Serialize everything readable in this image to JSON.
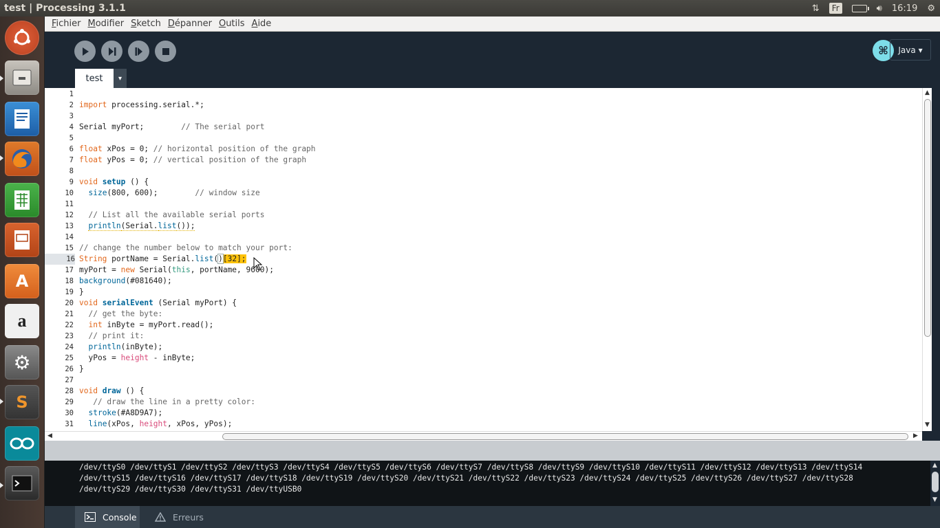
{
  "window": {
    "title": "test | Processing 3.1.1"
  },
  "tray": {
    "keyboard_layout": "Fr",
    "clock": "16:19"
  },
  "launcher": {
    "items": [
      {
        "name": "ubuntu-icon"
      },
      {
        "name": "files-icon"
      },
      {
        "name": "writer-icon"
      },
      {
        "name": "firefox-icon"
      },
      {
        "name": "calc-icon"
      },
      {
        "name": "impress-icon"
      },
      {
        "name": "software-center-icon"
      },
      {
        "name": "amazon-icon"
      },
      {
        "name": "system-settings-icon"
      },
      {
        "name": "sublime-text-icon"
      },
      {
        "name": "arduino-icon"
      },
      {
        "name": "terminal-icon"
      }
    ]
  },
  "menu": {
    "items": [
      {
        "first": "F",
        "rest": "ichier"
      },
      {
        "first": "M",
        "rest": "odifier"
      },
      {
        "first": "S",
        "rest": "ketch"
      },
      {
        "first": "D",
        "rest": "épanner"
      },
      {
        "first": "O",
        "rest": "utils"
      },
      {
        "first": "A",
        "rest": "ide"
      }
    ]
  },
  "toolbar": {
    "mode_label": "Java",
    "mode_arrow": "▾",
    "mode_icon_glyph": "⌘"
  },
  "tabs": {
    "active_label": "test",
    "menu_arrow": "▾"
  },
  "editor": {
    "line_numbers": [
      "1",
      "2",
      "3",
      "4",
      "5",
      "6",
      "7",
      "8",
      "9",
      "10",
      "11",
      "12",
      "13",
      "14",
      "15",
      "16",
      "17",
      "18",
      "19",
      "20",
      "21",
      "22",
      "23",
      "24",
      "25",
      "26",
      "27",
      "28",
      "29",
      "30",
      "31"
    ],
    "current_line": "16"
  },
  "console": {
    "lines": [
      "/dev/ttyS0 /dev/ttyS1 /dev/ttyS2 /dev/ttyS3 /dev/ttyS4 /dev/ttyS5 /dev/ttyS6 /dev/ttyS7 /dev/ttyS8 /dev/ttyS9 /dev/ttyS10 /dev/ttyS11 /dev/ttyS12 /dev/ttyS13 /dev/ttyS14",
      "/dev/ttyS15 /dev/ttyS16 /dev/ttyS17 /dev/ttyS18 /dev/ttyS19 /dev/ttyS20 /dev/ttyS21 /dev/ttyS22 /dev/ttyS23 /dev/ttyS24 /dev/ttyS25 /dev/ttyS26 /dev/ttyS27 /dev/ttyS28",
      "/dev/ttyS29 /dev/ttyS30 /dev/ttyS31 /dev/ttyUSB0"
    ]
  },
  "bottom_tabs": {
    "console_label": "Console",
    "errors_label": "Erreurs"
  },
  "colors": {
    "toolbar_bg": "#1c2733",
    "keyword_orange": "#e2661a",
    "function_blue": "#006699",
    "selection_yellow": "#ffc30b",
    "mode_icon_cyan": "#7ddde9"
  }
}
